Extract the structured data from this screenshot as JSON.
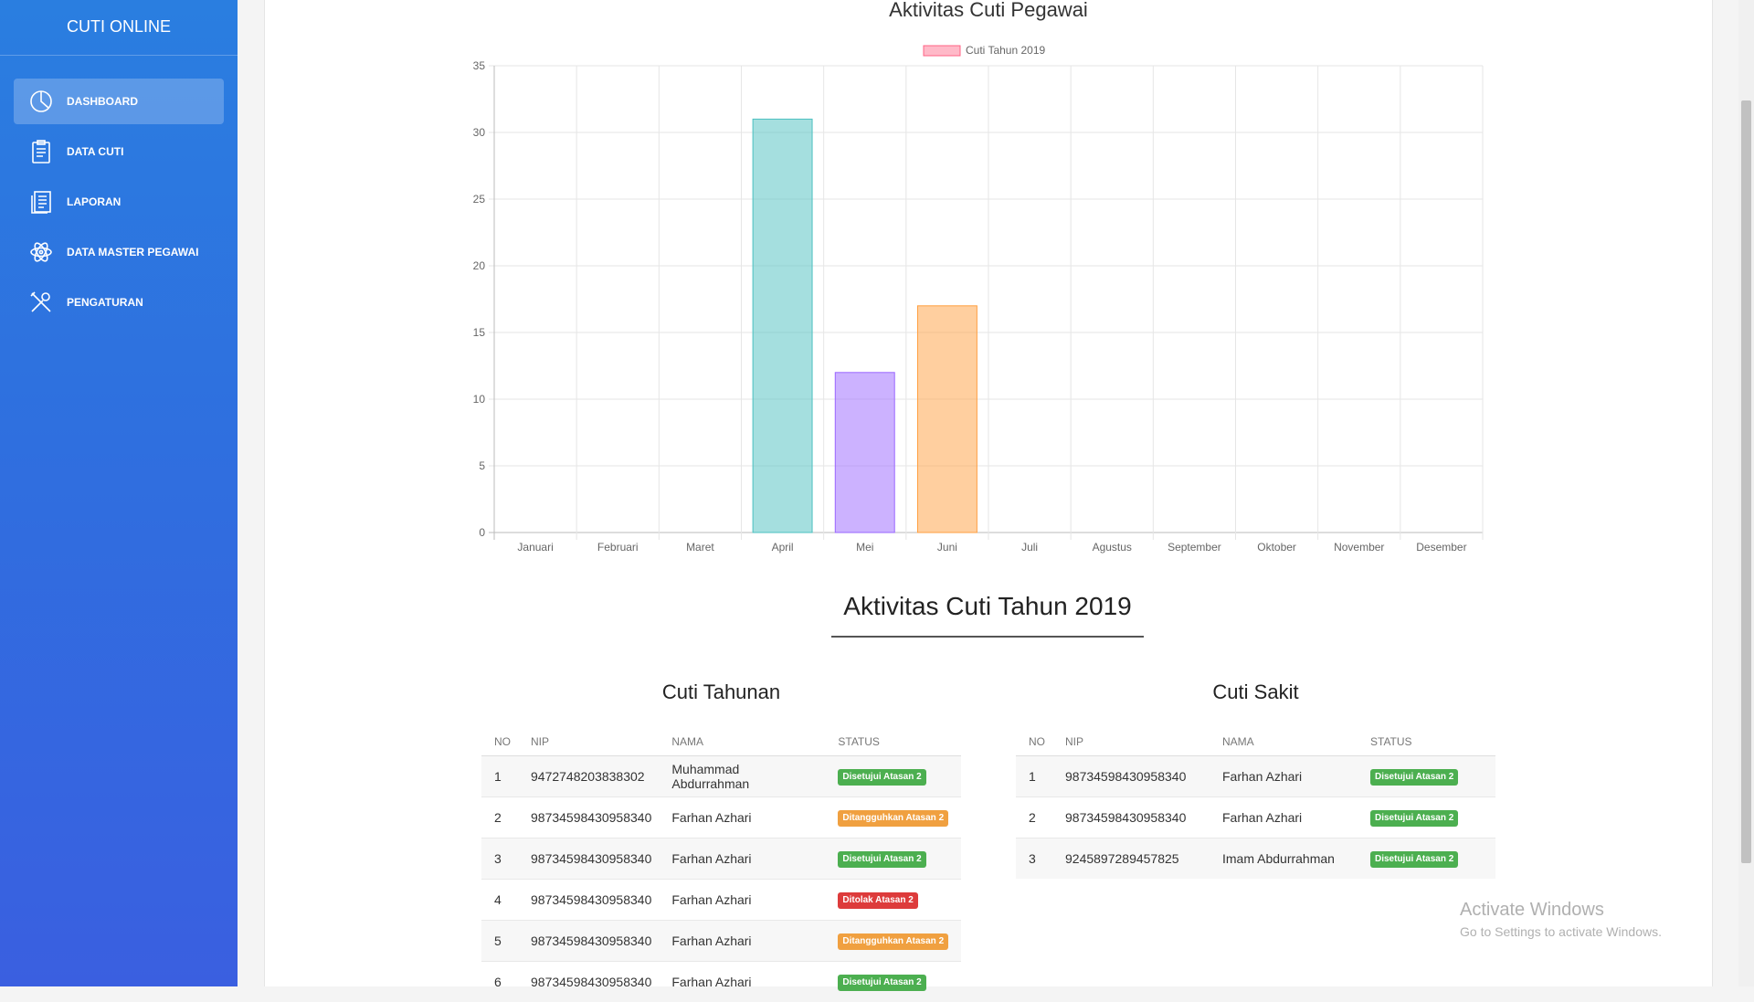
{
  "app": {
    "title": "CUTI ONLINE"
  },
  "sidebar": {
    "items": [
      {
        "label": "DASHBOARD",
        "icon": "pie-chart-icon",
        "active": true
      },
      {
        "label": "DATA CUTI",
        "icon": "clipboard-icon",
        "active": false
      },
      {
        "label": "LAPORAN",
        "icon": "report-icon",
        "active": false
      },
      {
        "label": "DATA MASTER PEGAWAI",
        "icon": "atom-icon",
        "active": false
      },
      {
        "label": "PENGATURAN",
        "icon": "tools-icon",
        "active": false
      }
    ]
  },
  "chart_data": {
    "type": "bar",
    "title": "Aktivitas Cuti Pegawai",
    "categories": [
      "Januari",
      "Februari",
      "Maret",
      "April",
      "Mei",
      "Juni",
      "Juli",
      "Agustus",
      "September",
      "Oktober",
      "November",
      "Desember"
    ],
    "series": [
      {
        "name": "Cuti Tahun 2019",
        "values": [
          0,
          0,
          0,
          31,
          12,
          17,
          0,
          0,
          0,
          0,
          0,
          0
        ]
      }
    ],
    "bar_colors": [
      "#ff6384",
      "#36a2eb",
      "#ffce56",
      "#4bc0c0",
      "#9966ff",
      "#ff9f40",
      "#ff6384",
      "#36a2eb",
      "#ffce56",
      "#4bc0c0",
      "#9966ff",
      "#ff9f40"
    ],
    "legend_color": "#ff6384",
    "ylim": [
      0,
      35
    ],
    "yticks": [
      0,
      5,
      10,
      15,
      20,
      25,
      30,
      35
    ],
    "grid": true,
    "legend_position": "top"
  },
  "section": {
    "title": "Aktivitas Cuti Tahun 2019"
  },
  "tables": {
    "headers": [
      "NO",
      "NIP",
      "NAMA",
      "STATUS"
    ],
    "tahunan": {
      "title": "Cuti Tahunan",
      "rows": [
        {
          "no": "1",
          "nip": "9472748203838302",
          "nama": "Muhammad Abdurrahman",
          "status": "Disetujui Atasan 2",
          "color": "green"
        },
        {
          "no": "2",
          "nip": "98734598430958340",
          "nama": "Farhan Azhari",
          "status": "Ditangguhkan Atasan 2",
          "color": "orange"
        },
        {
          "no": "3",
          "nip": "98734598430958340",
          "nama": "Farhan Azhari",
          "status": "Disetujui Atasan 2",
          "color": "green"
        },
        {
          "no": "4",
          "nip": "98734598430958340",
          "nama": "Farhan Azhari",
          "status": "Ditolak Atasan 2",
          "color": "red"
        },
        {
          "no": "5",
          "nip": "98734598430958340",
          "nama": "Farhan Azhari",
          "status": "Ditangguhkan Atasan 2",
          "color": "orange"
        },
        {
          "no": "6",
          "nip": "98734598430958340",
          "nama": "Farhan Azhari",
          "status": "Disetujui Atasan 2",
          "color": "green"
        }
      ]
    },
    "sakit": {
      "title": "Cuti Sakit",
      "rows": [
        {
          "no": "1",
          "nip": "98734598430958340",
          "nama": "Farhan Azhari",
          "status": "Disetujui Atasan 2",
          "color": "green"
        },
        {
          "no": "2",
          "nip": "98734598430958340",
          "nama": "Farhan Azhari",
          "status": "Disetujui Atasan 2",
          "color": "green"
        },
        {
          "no": "3",
          "nip": "9245897289457825",
          "nama": "Imam Abdurrahman",
          "status": "Disetujui Atasan 2",
          "color": "green"
        }
      ]
    }
  },
  "watermark": {
    "line1": "Activate Windows",
    "line2": "Go to Settings to activate Windows."
  }
}
